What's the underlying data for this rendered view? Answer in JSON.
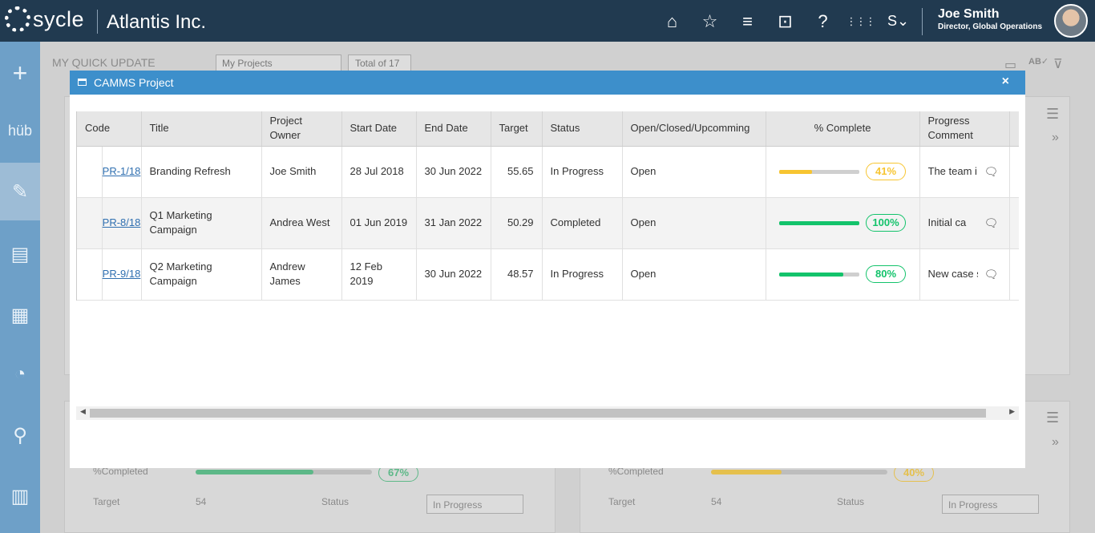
{
  "app": {
    "brand": "sycle",
    "org": "Atlantis Inc.",
    "user_name": "Joe Smith",
    "user_role": "Director, Global Operations",
    "nav_icons": [
      "home-icon",
      "star-icon",
      "menu-icon",
      "dashboard-icon",
      "help-icon",
      "apps-grid-icon",
      "sycle-switch-icon"
    ]
  },
  "sidebar": {
    "items": [
      {
        "name": "add-icon",
        "label": "+"
      },
      {
        "name": "hub-icon",
        "label": "hub"
      },
      {
        "name": "quick-update-icon",
        "label": ""
      },
      {
        "name": "report-search-icon",
        "label": ""
      },
      {
        "name": "calculator-clock-icon",
        "label": ""
      },
      {
        "name": "gauge-icon",
        "label": ""
      },
      {
        "name": "people-org-icon",
        "label": ""
      },
      {
        "name": "book-icon",
        "label": ""
      }
    ]
  },
  "background": {
    "page_title": "MY QUICK UPDATE",
    "project_filter": "My Projects",
    "total": "Total of 17",
    "card_left": {
      "completed_label": "%Completed",
      "completed_value": "67%",
      "completed_fraction": 0.67,
      "target_label": "Target",
      "target_value": "54",
      "status_label": "Status",
      "status_value": "In Progress"
    },
    "card_right": {
      "completed_label": "%Completed",
      "completed_value": "40%",
      "completed_fraction": 0.4,
      "target_label": "Target",
      "target_value": "54",
      "status_label": "Status",
      "status_value": "In Progress"
    }
  },
  "modal": {
    "title": "CAMMS Project",
    "close": "×",
    "columns": [
      "Code",
      "Title",
      "Project Owner",
      "Start Date",
      "End Date",
      "Target",
      "Status",
      "Open/Closed/Upcomming",
      "% Complete",
      "Progress Comment"
    ],
    "rows": [
      {
        "code": "PR-1/18",
        "title": "Branding Refresh",
        "owner": "Joe Smith",
        "start": "28 Jul 2018",
        "end": "30 Jun 2022",
        "target": "55.65",
        "status": "In Progress",
        "ocu": "Open",
        "complete": "41%",
        "complete_fraction": 0.41,
        "complete_color": "#f7c531",
        "comment": "The team i"
      },
      {
        "code": "PR-8/18",
        "title": "Q1 Marketing Campaign",
        "owner": "Andrea West",
        "start": "01 Jun 2019",
        "end": "31 Jan 2022",
        "target": "50.29",
        "status": "Completed",
        "ocu": "Open",
        "complete": "100%",
        "complete_fraction": 1.0,
        "complete_color": "#13c36b",
        "comment": "Initial ca"
      },
      {
        "code": "PR-9/18",
        "title": "Q2 Marketing Campaign",
        "owner": "Andrew James",
        "start": "12 Feb 2019",
        "end": "30 Jun 2022",
        "target": "48.57",
        "status": "In Progress",
        "ocu": "Open",
        "complete": "80%",
        "complete_fraction": 0.8,
        "complete_color": "#13c36b",
        "comment": "New case s"
      }
    ]
  }
}
